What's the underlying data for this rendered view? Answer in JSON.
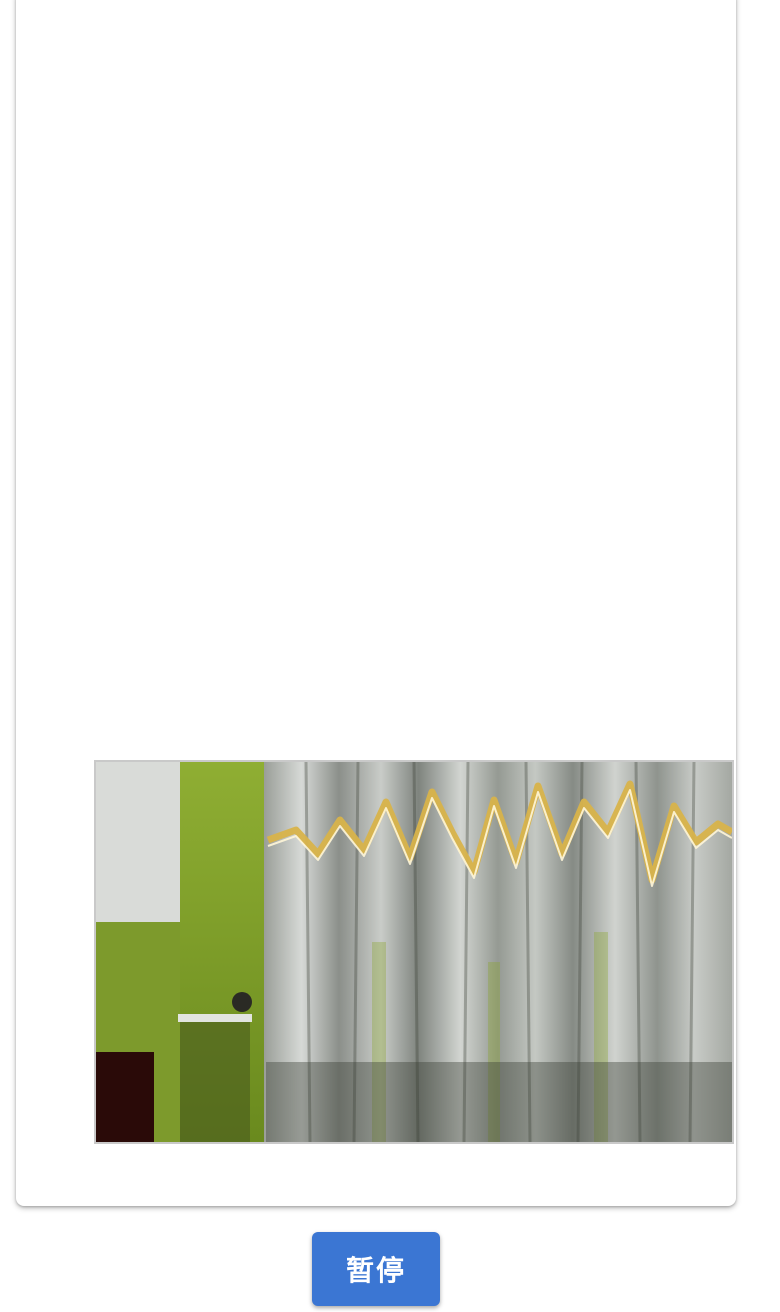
{
  "controls": {
    "pause_label": "暂停"
  },
  "video": {
    "state": "playing",
    "scene": "camera-feed"
  },
  "colors": {
    "button_bg": "#3b76d3",
    "button_text": "#ffffff",
    "card_bg": "#ffffff",
    "wall_green": "#7a9a2a",
    "foil_silver": "#b9bdb9",
    "foil_gold": "#d8b34a"
  }
}
